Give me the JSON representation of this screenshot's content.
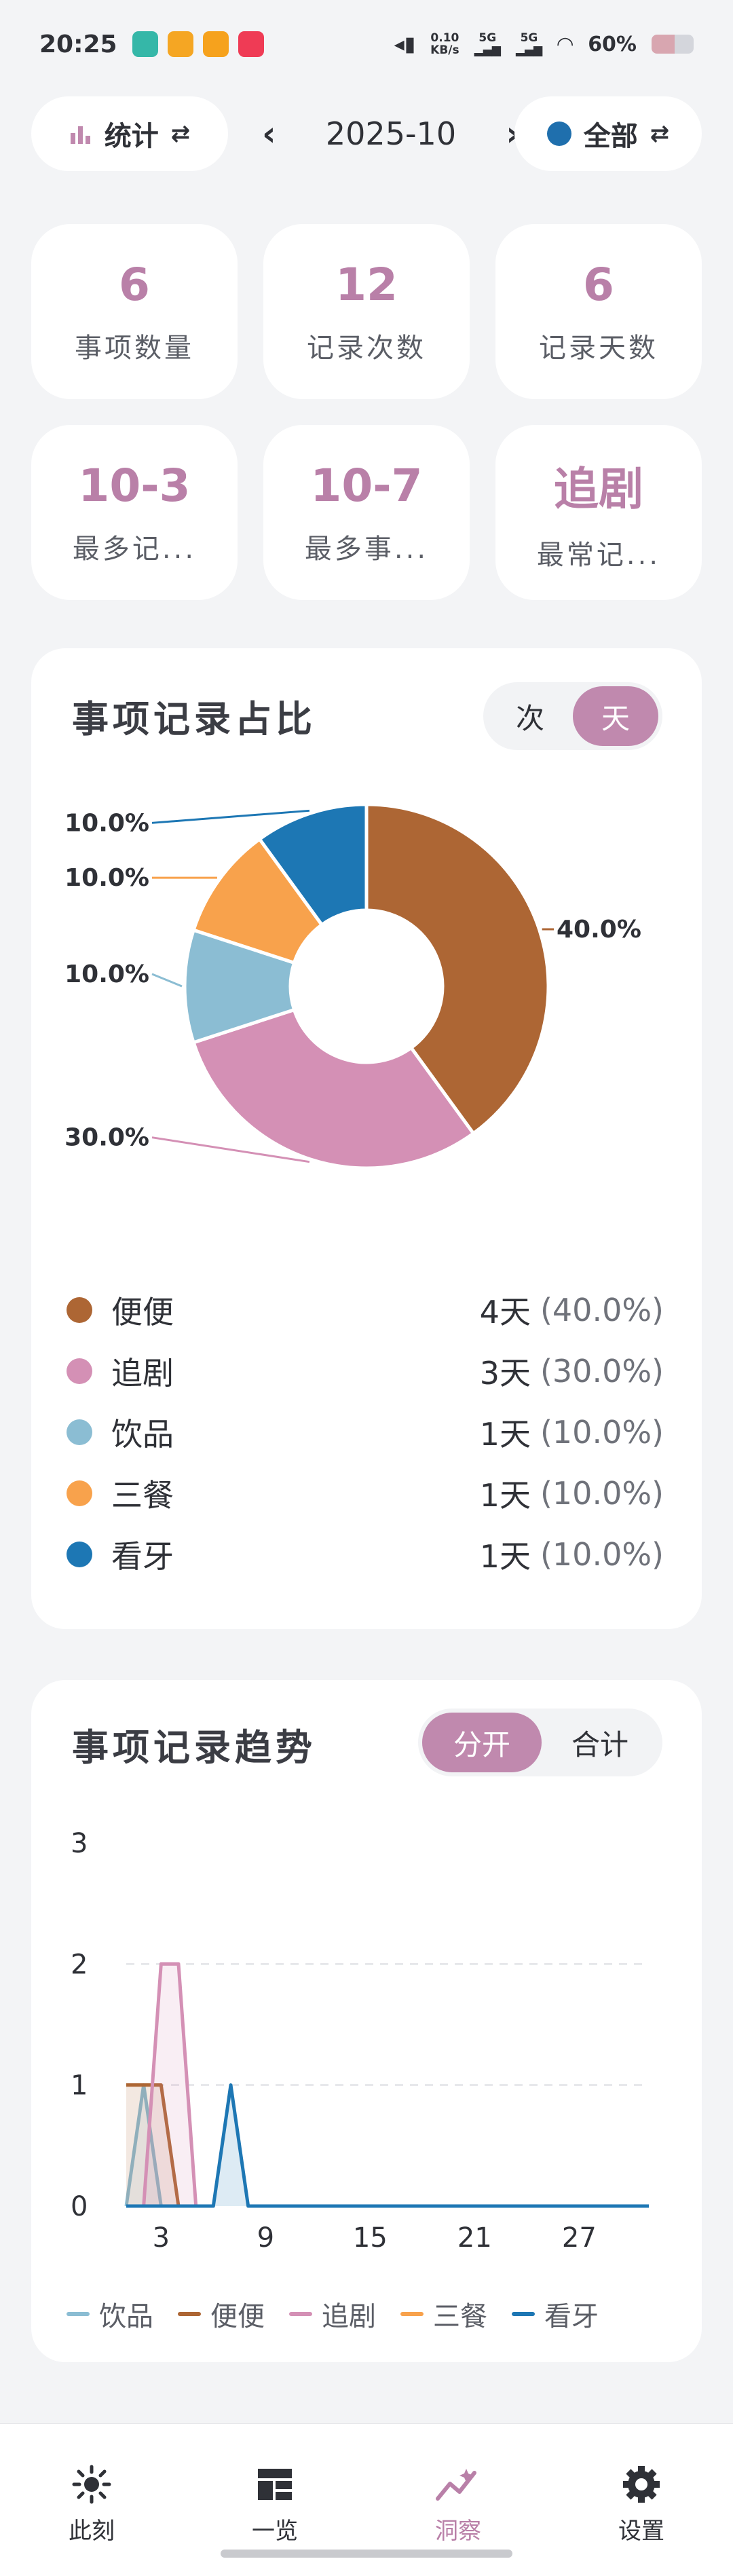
{
  "status": {
    "time": "20:25",
    "network_speed_top": "0.10",
    "network_speed_unit": "KB/s",
    "signal1": "5G",
    "signal2": "5G",
    "battery": "60%"
  },
  "topbar": {
    "stats_label": "统计",
    "month": "2025-10",
    "filter_label": "全部"
  },
  "stats": [
    {
      "value": "6",
      "label": "事项数量"
    },
    {
      "value": "12",
      "label": "记录次数"
    },
    {
      "value": "6",
      "label": "记录天数"
    },
    {
      "value": "10-3",
      "label": "最多记..."
    },
    {
      "value": "10-7",
      "label": "最多事..."
    },
    {
      "value": "追剧",
      "label": "最常记..."
    }
  ],
  "share_card": {
    "title": "事项记录占比",
    "toggle": [
      "次",
      "天"
    ],
    "active_toggle": "天",
    "legend": [
      {
        "name": "便便",
        "count": "4天",
        "pct": "(40.0%)",
        "color": "#ad6634"
      },
      {
        "name": "追剧",
        "count": "3天",
        "pct": "(30.0%)",
        "color": "#d490b5"
      },
      {
        "name": "饮品",
        "count": "1天",
        "pct": "(10.0%)",
        "color": "#8bbdd3"
      },
      {
        "name": "三餐",
        "count": "1天",
        "pct": "(10.0%)",
        "color": "#f8a24c"
      },
      {
        "name": "看牙",
        "count": "1天",
        "pct": "(10.0%)",
        "color": "#1d77b4"
      }
    ]
  },
  "chart_data": [
    {
      "type": "pie",
      "title": "事项记录占比",
      "categories": [
        "便便",
        "追剧",
        "饮品",
        "三餐",
        "看牙"
      ],
      "values": [
        40.0,
        30.0,
        10.0,
        10.0,
        10.0
      ],
      "labels": [
        "40.0%",
        "30.0%",
        "10.0%",
        "10.0%",
        "10.0%"
      ],
      "colors": [
        "#ad6634",
        "#d490b5",
        "#8bbdd3",
        "#f8a24c",
        "#1d77b4"
      ],
      "donut": true
    },
    {
      "type": "line",
      "title": "事项记录趋势",
      "x_ticks": [
        "3",
        "9",
        "15",
        "21",
        "27"
      ],
      "y_ticks": [
        "0",
        "1",
        "2",
        "3"
      ],
      "xlim": [
        1,
        31
      ],
      "ylim": [
        0,
        3
      ],
      "grid": "horizontal dashed",
      "legend_position": "bottom",
      "series": [
        {
          "name": "饮品",
          "color": "#8bbdd3",
          "points": [
            [
              1,
              0
            ],
            [
              2,
              1
            ],
            [
              3,
              0
            ]
          ]
        },
        {
          "name": "便便",
          "color": "#ad6634",
          "points": [
            [
              1,
              1
            ],
            [
              3,
              1
            ],
            [
              4,
              0
            ]
          ]
        },
        {
          "name": "追剧",
          "color": "#d490b5",
          "points": [
            [
              2,
              0
            ],
            [
              3,
              2
            ],
            [
              4,
              2
            ],
            [
              5,
              0
            ]
          ]
        },
        {
          "name": "三餐",
          "color": "#f8a24c",
          "points": [
            [
              1,
              0
            ],
            [
              2,
              0
            ]
          ]
        },
        {
          "name": "看牙",
          "color": "#1d77b4",
          "points": [
            [
              1,
              0
            ],
            [
              6,
              0
            ],
            [
              7,
              1
            ],
            [
              8,
              0
            ],
            [
              31,
              0
            ]
          ]
        }
      ]
    }
  ],
  "trend_card": {
    "title": "事项记录趋势",
    "toggle": [
      "分开",
      "合计"
    ],
    "active_toggle": "分开"
  },
  "nav": [
    {
      "label": "此刻",
      "icon": "sun-icon"
    },
    {
      "label": "一览",
      "icon": "grid-icon"
    },
    {
      "label": "洞察",
      "icon": "trend-icon"
    },
    {
      "label": "设置",
      "icon": "gear-icon"
    }
  ],
  "active_nav": "洞察"
}
